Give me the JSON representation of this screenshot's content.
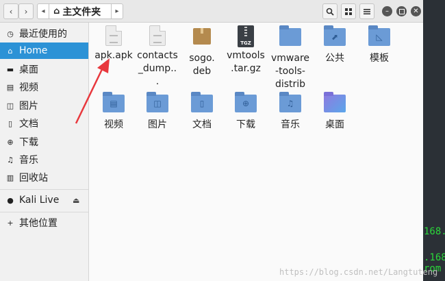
{
  "header": {
    "breadcrumb": "主文件夹"
  },
  "sidebar": {
    "items": [
      {
        "label": "最近使用的",
        "icon": "clock-icon",
        "glyph": "◷"
      },
      {
        "label": "Home",
        "icon": "home-icon",
        "glyph": "⌂",
        "active": true
      },
      {
        "label": "桌面",
        "icon": "desktop-icon",
        "glyph": "▬"
      },
      {
        "label": "视频",
        "icon": "video-icon",
        "glyph": "▤"
      },
      {
        "label": "图片",
        "icon": "picture-icon",
        "glyph": "◫"
      },
      {
        "label": "文档",
        "icon": "document-icon",
        "glyph": "▯"
      },
      {
        "label": "下载",
        "icon": "download-icon",
        "glyph": "⊕"
      },
      {
        "label": "音乐",
        "icon": "music-icon",
        "glyph": "♫"
      },
      {
        "label": "回收站",
        "icon": "trash-icon",
        "glyph": "▥"
      }
    ],
    "devices": [
      {
        "label": "Kali Live",
        "icon": "disk-icon",
        "glyph": "●"
      }
    ],
    "other": {
      "label": "其他位置",
      "icon": "plus-icon",
      "glyph": "+"
    }
  },
  "files": [
    {
      "name": "apk.apk",
      "icon": "document-icon"
    },
    {
      "name": "contacts_dump...",
      "icon": "document-icon"
    },
    {
      "name": "sogo.deb",
      "icon": "package-icon"
    },
    {
      "name": "vmtools.tar.gz",
      "icon": "archive-icon"
    },
    {
      "name": "vmware-tools-distrib",
      "icon": "folder-icon"
    },
    {
      "name": "公共",
      "icon": "folder-share-icon"
    },
    {
      "name": "模板",
      "icon": "folder-templates-icon"
    },
    {
      "name": "视频",
      "icon": "folder-video-icon"
    },
    {
      "name": "图片",
      "icon": "folder-picture-icon"
    },
    {
      "name": "文档",
      "icon": "folder-document-icon"
    },
    {
      "name": "下载",
      "icon": "folder-download-icon"
    },
    {
      "name": "音乐",
      "icon": "folder-music-icon"
    },
    {
      "name": "桌面",
      "icon": "folder-desktop-icon"
    }
  ],
  "background": {
    "term1": "168.",
    "term2": ".168",
    "term3": "rom"
  },
  "watermark": "https://blog.csdn.net/Langtuteng",
  "colors": {
    "accent": "#2c92d6",
    "folder": "#6b9bd6",
    "annotation": "#e8383d"
  }
}
